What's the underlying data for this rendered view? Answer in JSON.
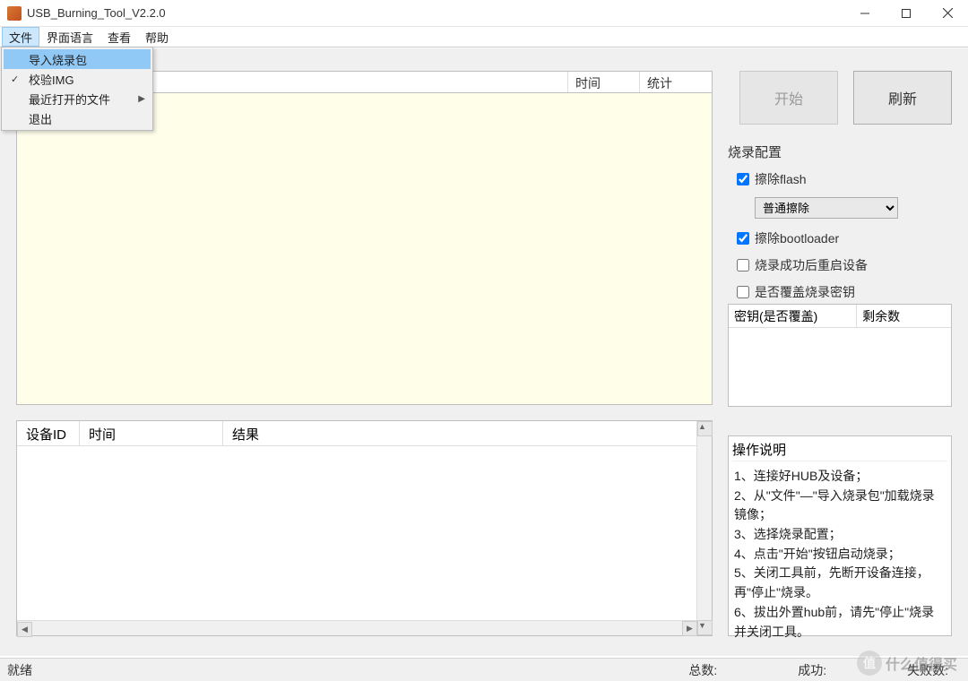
{
  "window": {
    "title": "USB_Burning_Tool_V2.2.0"
  },
  "menu": {
    "items": [
      "文件",
      "界面语言",
      "查看",
      "帮助"
    ],
    "open_index": 0,
    "dropdown": [
      {
        "label": "导入烧录包",
        "highlighted": true,
        "checked": false,
        "submenu": false
      },
      {
        "label": "校验IMG",
        "highlighted": false,
        "checked": true,
        "submenu": false
      },
      {
        "label": "最近打开的文件",
        "highlighted": false,
        "checked": false,
        "submenu": true
      },
      {
        "label": "退出",
        "highlighted": false,
        "checked": false,
        "submenu": false
      }
    ]
  },
  "upper_table_headers": {
    "col_time": "时间",
    "col_stats": "统计"
  },
  "buttons": {
    "start": "开始",
    "refresh": "刷新"
  },
  "config": {
    "title": "烧录配置",
    "erase_flash_label": "擦除flash",
    "erase_flash_checked": true,
    "erase_mode_selected": "普通擦除",
    "erase_bootloader_label": "擦除bootloader",
    "erase_bootloader_checked": true,
    "reboot_label": "烧录成功后重启设备",
    "reboot_checked": false,
    "override_key_label": "是否覆盖烧录密钥",
    "override_key_checked": false
  },
  "keys_box": {
    "col_key": "密钥(是否覆盖)",
    "col_remain": "剩余数"
  },
  "device_table": {
    "col_id": "设备ID",
    "col_time": "时间",
    "col_result": "结果"
  },
  "instructions": {
    "title": "操作说明",
    "lines": [
      "1、连接好HUB及设备；",
      "2、从\"文件\"—\"导入烧录包\"加载烧录镜像；",
      "3、选择烧录配置；",
      "4、点击\"开始\"按钮启动烧录；",
      "5、关闭工具前，先断开设备连接，再\"停止\"烧录。",
      "6、拔出外置hub前，请先\"停止\"烧录并关闭工具。"
    ]
  },
  "status": {
    "ready": "就绪",
    "total": "总数:",
    "success": "成功:",
    "fail": "失败数:"
  },
  "watermark": {
    "badge": "值",
    "text": "什么值得买"
  }
}
